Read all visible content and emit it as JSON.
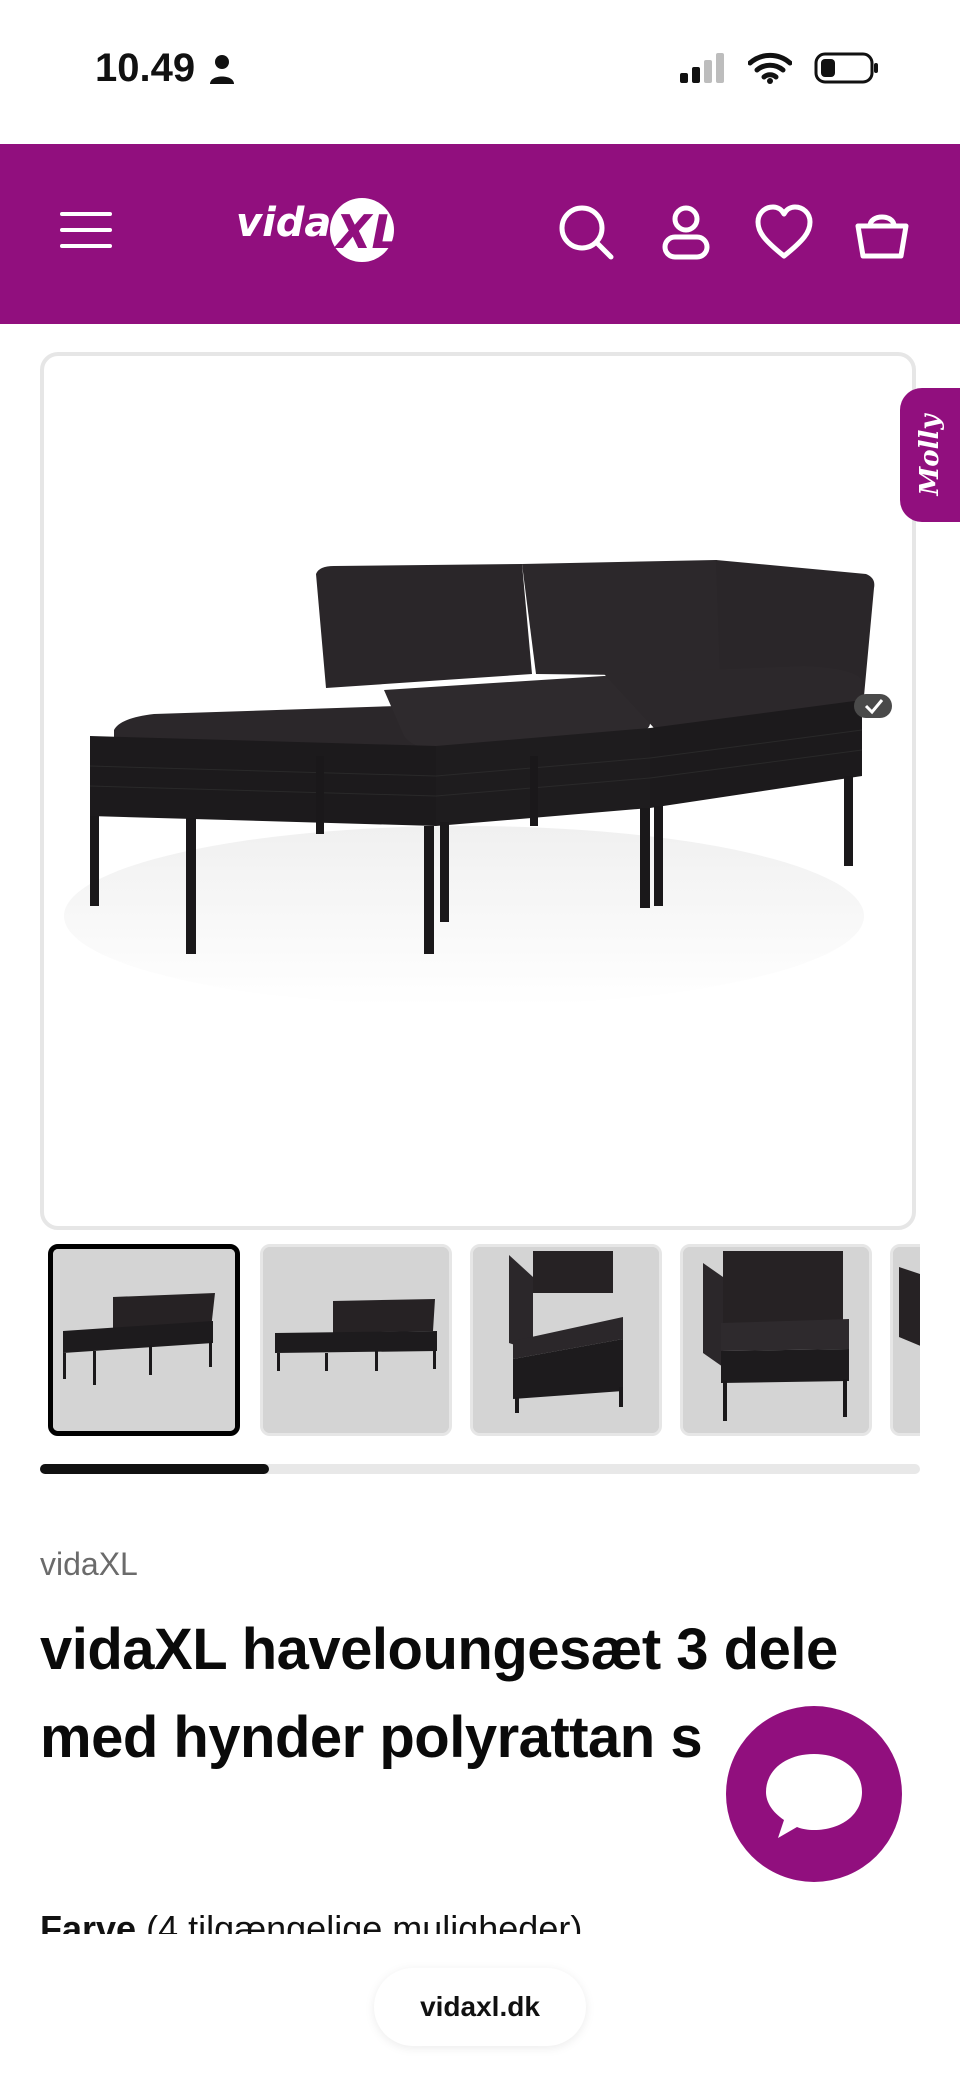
{
  "status_bar": {
    "time": "10.49",
    "icons": [
      "person-icon",
      "signal-icon",
      "wifi-icon",
      "battery-icon"
    ]
  },
  "header": {
    "logo_text": "vidaXL",
    "icons": [
      "menu-icon",
      "search-icon",
      "account-icon",
      "heart-icon",
      "basket-icon"
    ],
    "brand_color": "#910f7e"
  },
  "molly": {
    "label": "Molly"
  },
  "gallery": {
    "thumbnails": [
      "thumbnail-1",
      "thumbnail-2",
      "thumbnail-3",
      "thumbnail-4",
      "thumbnail-5"
    ],
    "active_index": 0,
    "scroll_progress": 0.26
  },
  "product": {
    "brand": "vidaXL",
    "title": "vidaXL haveloungesæt 3 dele med hynder polyrattan s",
    "option_label": "Farve",
    "option_count_text": "(4 tilgængelige muligheder)"
  },
  "footer": {
    "url": "vidaxl.dk"
  }
}
